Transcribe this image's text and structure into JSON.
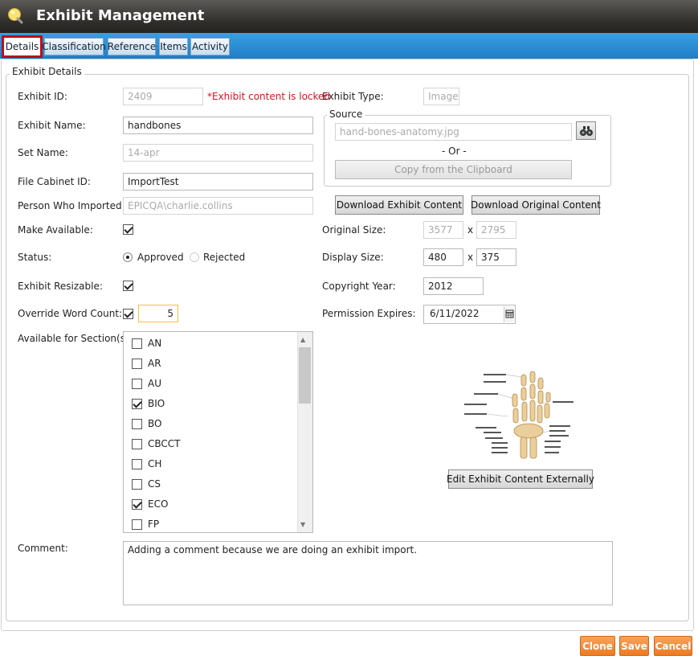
{
  "window": {
    "title": "Exhibit Management"
  },
  "tabs": [
    {
      "label": "Details"
    },
    {
      "label": "Classification"
    },
    {
      "label": "Reference"
    },
    {
      "label": "Items"
    },
    {
      "label": "Activity"
    }
  ],
  "details": {
    "group_title": "Exhibit Details",
    "exhibit_id": {
      "label": "Exhibit ID:",
      "value": "2409",
      "locked_note": "*Exhibit content is locked"
    },
    "exhibit_name": {
      "label": "Exhibit Name:",
      "value": "handbones"
    },
    "set_name": {
      "label": "Set Name:",
      "value": "14-apr"
    },
    "file_cabinet_id": {
      "label": "File Cabinet ID:",
      "value": "ImportTest"
    },
    "person_imported": {
      "label": "Person Who Imported:",
      "value": "EPICQA\\charlie.collins"
    },
    "make_available": {
      "label": "Make Available:",
      "checked": true
    },
    "status": {
      "label": "Status:",
      "options": [
        "Approved",
        "Rejected"
      ],
      "selected": "Approved"
    },
    "exhibit_resizable": {
      "label": "Exhibit Resizable:",
      "checked": true
    },
    "override_word_count": {
      "label": "Override Word Count:",
      "checked": true,
      "value": "5"
    },
    "sections": {
      "label": "Available for Section(s)",
      "items": [
        {
          "code": "AN",
          "checked": false
        },
        {
          "code": "AR",
          "checked": false
        },
        {
          "code": "AU",
          "checked": false
        },
        {
          "code": "BIO",
          "checked": true
        },
        {
          "code": "BO",
          "checked": false
        },
        {
          "code": "CBCCT",
          "checked": false
        },
        {
          "code": "CH",
          "checked": false
        },
        {
          "code": "CS",
          "checked": false
        },
        {
          "code": "ECO",
          "checked": true
        },
        {
          "code": "FP",
          "checked": false
        }
      ]
    },
    "comment": {
      "label": "Comment:",
      "value": "Adding a comment because we are doing an exhibit import."
    }
  },
  "right": {
    "exhibit_type": {
      "label": "Exhibit Type:",
      "value": "Image"
    },
    "source": {
      "title": "Source",
      "file": "hand-bones-anatomy.jpg",
      "or_text": "- Or -",
      "clipboard_button": "Copy from the Clipboard"
    },
    "download_exhibit_button": "Download Exhibit Content",
    "download_original_button": "Download Original Content",
    "original_size": {
      "label": "Original Size:",
      "width": "3577",
      "height": "2795",
      "sep": "x"
    },
    "display_size": {
      "label": "Display Size:",
      "width": "480",
      "height": "375",
      "sep": "x"
    },
    "copyright_year": {
      "label": "Copyright Year:",
      "value": "2012"
    },
    "permission_expires": {
      "label": "Permission Expires:",
      "value": "6/11/2022"
    },
    "edit_button": "Edit Exhibit Content Externally"
  },
  "footer": {
    "clone": "Clone",
    "save": "Save",
    "cancel": "Cancel"
  },
  "colors": {
    "accent_tab_bar": "#1f7fc8",
    "active_tab_border": "#b8101b",
    "locked_note": "#d4151f",
    "action_button": "#ee7a20",
    "override_highlight": "#f0c23c"
  },
  "icons": {
    "title": "lightbulb-icon",
    "browse": "binoculars-icon",
    "calendar": "calendar-icon"
  }
}
